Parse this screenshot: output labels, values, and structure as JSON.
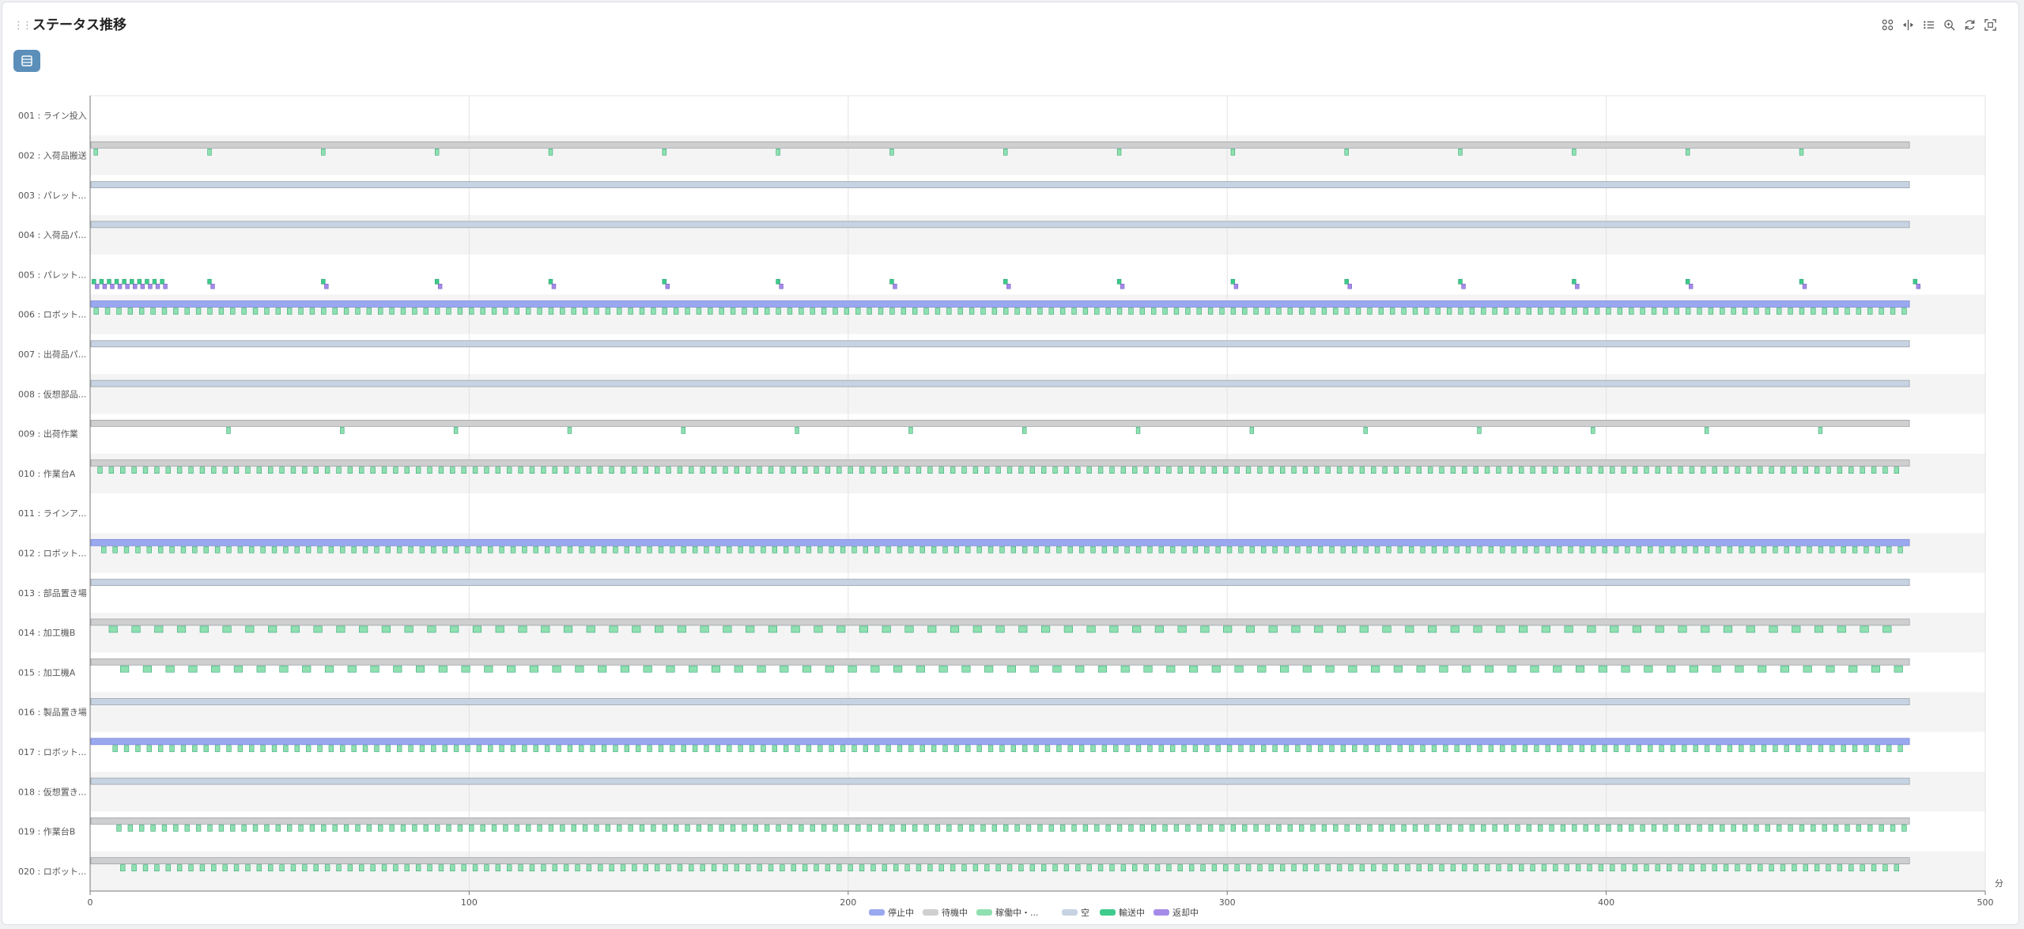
{
  "header": {
    "title": "ステータス推移"
  },
  "toolbar": [
    {
      "name": "brush-icon"
    },
    {
      "name": "split-icon"
    },
    {
      "name": "list-icon"
    },
    {
      "name": "zoom-icon"
    },
    {
      "name": "refresh-icon"
    },
    {
      "name": "fullscreen-icon"
    }
  ],
  "chart_data": {
    "type": "gantt",
    "x_unit": "分",
    "xlim": [
      0,
      500
    ],
    "x_ticks": [
      0,
      100,
      200,
      300,
      400,
      500
    ],
    "grid": true,
    "legend_position": "bottom",
    "legend": [
      {
        "key": "stopped",
        "label": "停止中",
        "color": "#9aa8f0"
      },
      {
        "key": "waiting",
        "label": "待機中",
        "color": "#cfcfcf"
      },
      {
        "key": "running",
        "label": "稼働中・...",
        "color": "#8fe0b0"
      },
      {
        "key": "empty",
        "label": "空",
        "color": "#c6d3e3"
      },
      {
        "key": "transporting",
        "label": "輸送中",
        "color": "#3ecb8c"
      },
      {
        "key": "returning",
        "label": "返却中",
        "color": "#a58be8"
      }
    ],
    "end_time": 480,
    "rows": [
      {
        "label": "001 : ライン投入",
        "base": null
      },
      {
        "label": "002 : 入荷品搬送",
        "base": "waiting",
        "pulses": {
          "status": "running",
          "start": 1,
          "period": 30,
          "width": 1
        }
      },
      {
        "label": "003 : パレット...",
        "base": "empty"
      },
      {
        "label": "004 : 入荷品パ...",
        "base": "empty"
      },
      {
        "label": "005 : パレット...",
        "base": null,
        "custom": "pallet"
      },
      {
        "label": "006 : ロボット...",
        "base": "stopped",
        "pulses": {
          "status": "running",
          "start": 1,
          "period": 3,
          "width": 1.2
        }
      },
      {
        "label": "007 : 出荷品パ...",
        "base": "empty"
      },
      {
        "label": "008 : 仮想部品...",
        "base": "empty"
      },
      {
        "label": "009 : 出荷作業",
        "base": "waiting",
        "pulses": {
          "status": "running",
          "start": 36,
          "period": 30,
          "width": 1
        }
      },
      {
        "label": "010 : 作業台A",
        "base": "waiting",
        "pulses": {
          "status": "running",
          "start": 2,
          "period": 3,
          "width": 1.2
        }
      },
      {
        "label": "011 : ラインア...",
        "base": null
      },
      {
        "label": "012 : ロボット...",
        "base": "stopped",
        "pulses": {
          "status": "running",
          "start": 3,
          "period": 3,
          "width": 1.2
        }
      },
      {
        "label": "013 : 部品置き場",
        "base": "empty"
      },
      {
        "label": "014 : 加工機B",
        "base": "waiting",
        "pulses": {
          "status": "running",
          "start": 5,
          "period": 6,
          "width": 2.2
        }
      },
      {
        "label": "015 : 加工機A",
        "base": "waiting",
        "pulses": {
          "status": "running",
          "start": 8,
          "period": 6,
          "width": 2.2
        }
      },
      {
        "label": "016 : 製品置き場",
        "base": "empty"
      },
      {
        "label": "017 : ロボット...",
        "base": "stopped",
        "pulses": {
          "status": "running",
          "start": 6,
          "period": 3,
          "width": 1.2
        }
      },
      {
        "label": "018 : 仮想置き...",
        "base": "empty"
      },
      {
        "label": "019 : 作業台B",
        "base": "waiting",
        "pulses": {
          "status": "running",
          "start": 7,
          "period": 3,
          "width": 1.2
        }
      },
      {
        "label": "020 : ロボット...",
        "base": "waiting",
        "pulses": {
          "status": "running",
          "start": 8,
          "period": 3,
          "width": 1.2
        }
      }
    ],
    "pallet_row": {
      "early": {
        "start": 0.5,
        "period": 2,
        "count": 10,
        "width": 1
      },
      "later": {
        "start": 31,
        "period": 30,
        "count": 16,
        "width": 1
      }
    }
  }
}
